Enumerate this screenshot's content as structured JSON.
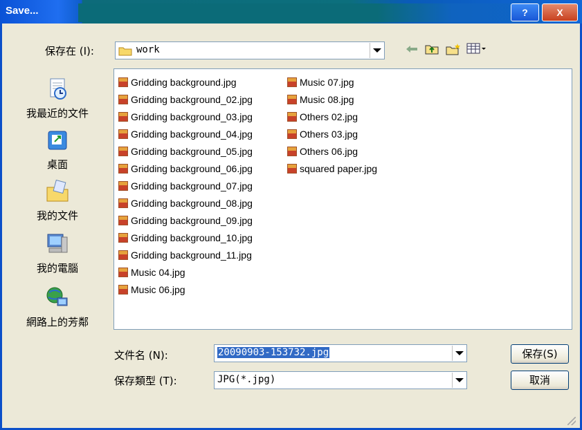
{
  "window": {
    "title": "Save..."
  },
  "titlebar": {
    "help": "?",
    "close": "X"
  },
  "save_in": {
    "label": "保存在 (I):",
    "value": "work"
  },
  "places": [
    {
      "label": "我最近的文件",
      "icon": "recent-documents-icon"
    },
    {
      "label": "桌面",
      "icon": "desktop-icon"
    },
    {
      "label": "我的文件",
      "icon": "my-documents-icon"
    },
    {
      "label": "我的電腦",
      "icon": "my-computer-icon"
    },
    {
      "label": "網路上的芳鄰",
      "icon": "network-places-icon"
    }
  ],
  "files_col1": [
    "Gridding background.jpg",
    "Gridding background_02.jpg",
    "Gridding background_03.jpg",
    "Gridding background_04.jpg",
    "Gridding background_05.jpg",
    "Gridding background_06.jpg",
    "Gridding background_07.jpg",
    "Gridding background_08.jpg",
    "Gridding background_09.jpg",
    "Gridding background_10.jpg",
    "Gridding background_11.jpg",
    "Music 04.jpg",
    "Music 06.jpg"
  ],
  "files_col2": [
    "Music 07.jpg",
    "Music 08.jpg",
    "Others 02.jpg",
    "Others 03.jpg",
    "Others 06.jpg",
    "squared paper.jpg"
  ],
  "filename": {
    "label": "文件名 (N):",
    "value": "20090903-153732.jpg"
  },
  "filetype": {
    "label": "保存類型 (T):",
    "value": "JPG(*.jpg)"
  },
  "buttons": {
    "save": "保存(S)",
    "cancel": "取消"
  }
}
